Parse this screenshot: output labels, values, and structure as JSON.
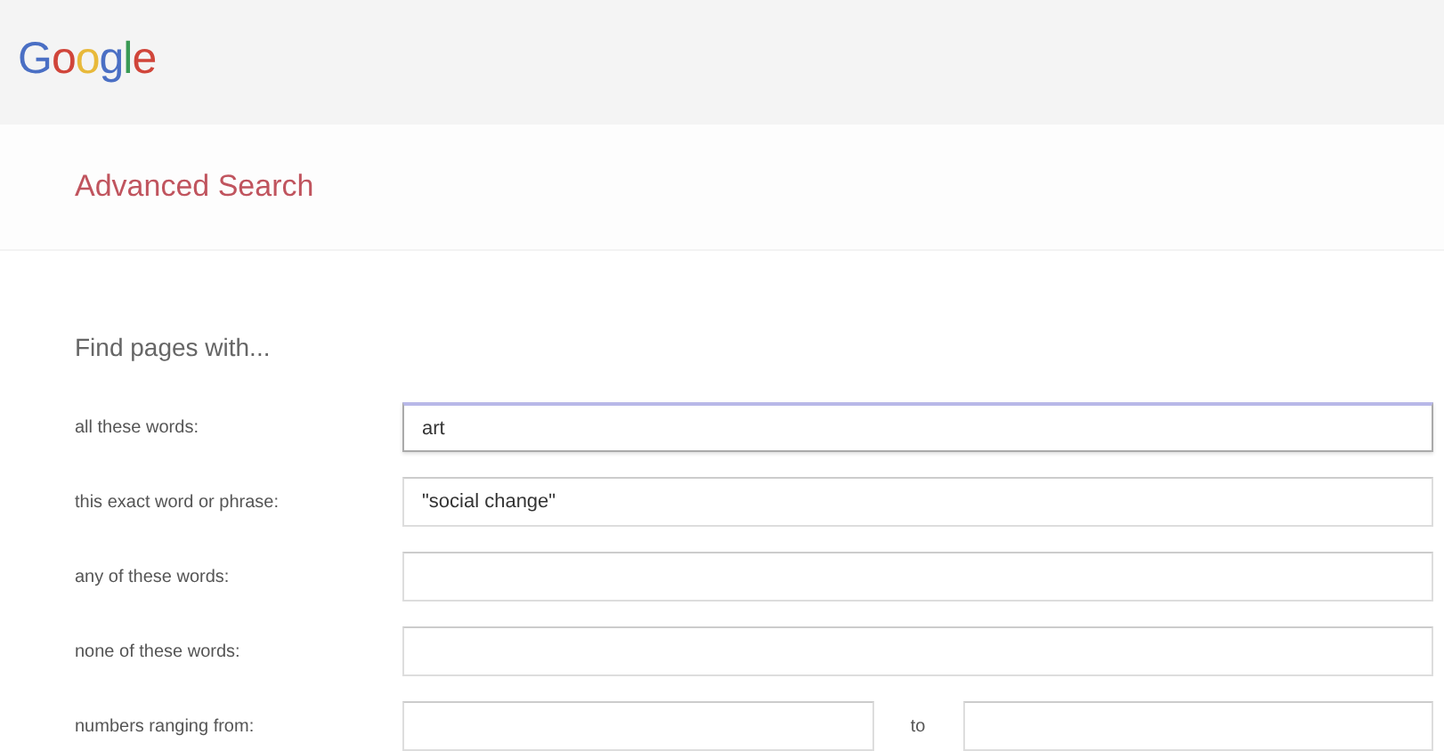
{
  "logo": "Google",
  "page_title": "Advanced Search",
  "section_title": "Find pages with...",
  "rows": [
    {
      "kind": "text",
      "label": "all these words:",
      "value": "art",
      "focused": true
    },
    {
      "kind": "text",
      "label": "this exact word or phrase:",
      "value": "\"social change\"",
      "focused": false
    },
    {
      "kind": "text",
      "label": "any of these words:",
      "focused": false
    },
    {
      "kind": "text",
      "label": "none of these words:",
      "focused": false
    },
    {
      "kind": "range",
      "label": "numbers ranging from:",
      "separator": "to",
      "focused": false
    }
  ]
}
